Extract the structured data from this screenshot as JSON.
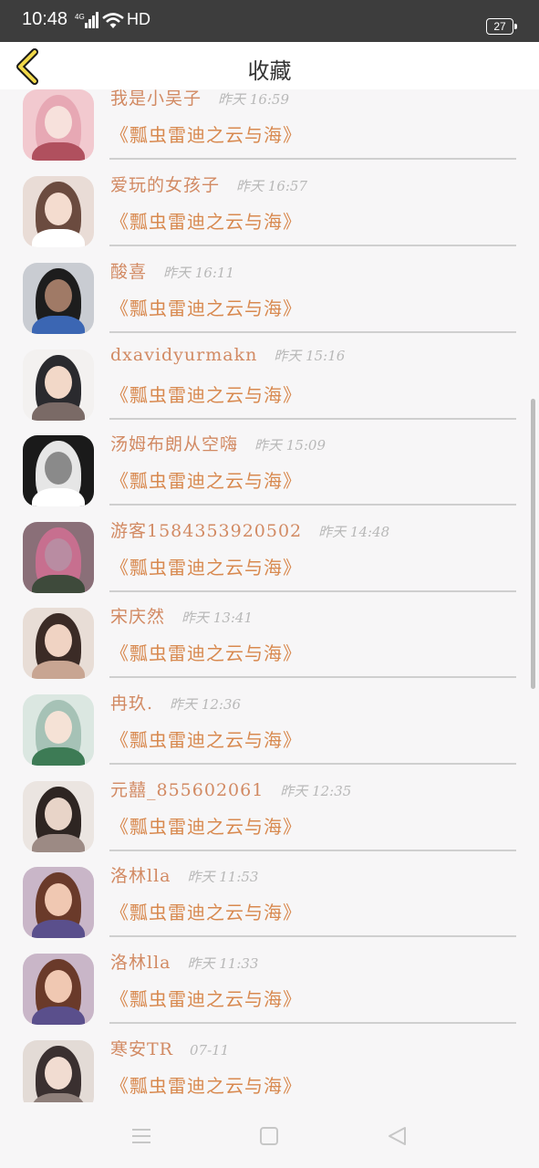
{
  "status_bar": {
    "time": "10:48",
    "network": "4G",
    "hd": "HD",
    "battery": "27"
  },
  "header": {
    "title": "收藏",
    "back_icon": "chevron-left-icon"
  },
  "items": [
    {
      "username": "我是小吴子",
      "time": "昨天 16:59",
      "work": "《瓢虫雷迪之云与海》"
    },
    {
      "username": "爱玩的女孩子",
      "time": "昨天 16:57",
      "work": "《瓢虫雷迪之云与海》"
    },
    {
      "username": "酸喜",
      "time": "昨天 16:11",
      "work": "《瓢虫雷迪之云与海》"
    },
    {
      "username": "dxavidyurmakn",
      "time": "昨天 15:16",
      "work": "《瓢虫雷迪之云与海》"
    },
    {
      "username": "汤姆布朗从空嗨",
      "time": "昨天 15:09",
      "work": "《瓢虫雷迪之云与海》"
    },
    {
      "username": "游客1584353920502",
      "time": "昨天 14:48",
      "work": "《瓢虫雷迪之云与海》"
    },
    {
      "username": "宋庆然",
      "time": "昨天 13:41",
      "work": "《瓢虫雷迪之云与海》"
    },
    {
      "username": "冉玖.",
      "time": "昨天 12:36",
      "work": "《瓢虫雷迪之云与海》"
    },
    {
      "username": "元囍_855602061",
      "time": "昨天 12:35",
      "work": "《瓢虫雷迪之云与海》"
    },
    {
      "username": "洛林lla",
      "time": "昨天 11:53",
      "work": "《瓢虫雷迪之云与海》"
    },
    {
      "username": "洛林lla",
      "time": "昨天 11:33",
      "work": "《瓢虫雷迪之云与海》"
    },
    {
      "username": "寒安TR",
      "time": "07-11",
      "work": "《瓢虫雷迪之云与海》"
    }
  ],
  "nav": {
    "menu_icon": "menu-icon",
    "home_icon": "home-square-icon",
    "back_icon": "back-triangle-icon"
  }
}
